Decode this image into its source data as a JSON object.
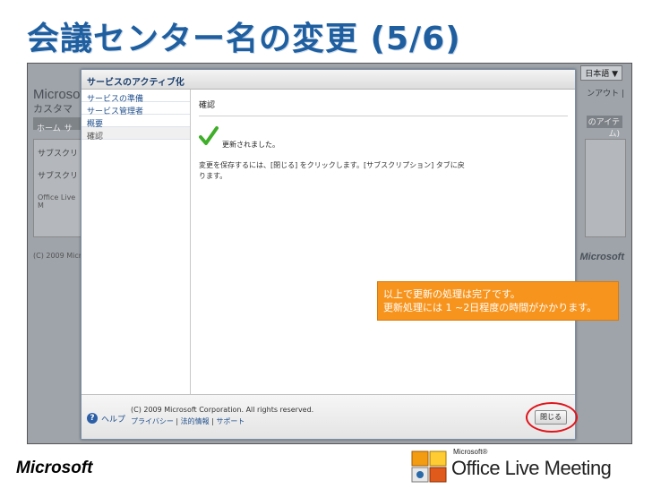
{
  "slide": {
    "title": "会議センター名の変更 (5/6)"
  },
  "background_page": {
    "language": "日本語 ▼",
    "logo_line1": "Microsof",
    "logo_line2": "カスタマ",
    "nav_home": "ホーム",
    "nav_sub": "サ",
    "right_link": "ンアウト |",
    "right_tab": "のアイテム)",
    "panel_title": "サブスクリ",
    "panel_sub": "サブスクリ",
    "panel_office": "Office Live M",
    "footer": "(C) 2009 Micro",
    "ms_logo": "Microsoft"
  },
  "dialog": {
    "header_title": "サービスのアクティブ化",
    "steps": [
      {
        "label": "サービスの準備"
      },
      {
        "label": "サービス管理者"
      },
      {
        "label": "概要"
      },
      {
        "label": "確認"
      }
    ],
    "content_title": "確認",
    "success_message": "更新されました。",
    "instructions": "変更を保存するには、[閉じる] をクリックします。[サブスクリプション] タブに戻ります。",
    "help_label": "ヘルプ",
    "copyright": "(C) 2009 Microsoft Corporation. All rights reserved.",
    "links": [
      "プライバシー",
      "法的情報",
      "サポート"
    ],
    "close_label": "閉じる"
  },
  "callout": {
    "line1": "以上で更新の処理は完了です。",
    "line2": "更新処理には 1 ~2日程度の時間がかかります。"
  },
  "footer_logos": {
    "microsoft": "Microsoft",
    "olm_small": "Microsoft®",
    "olm_name": "Office Live Meeting"
  },
  "colors": {
    "title_blue": "#1f5fa0",
    "callout_orange": "#f7941d",
    "highlight_red": "#e0141b"
  }
}
